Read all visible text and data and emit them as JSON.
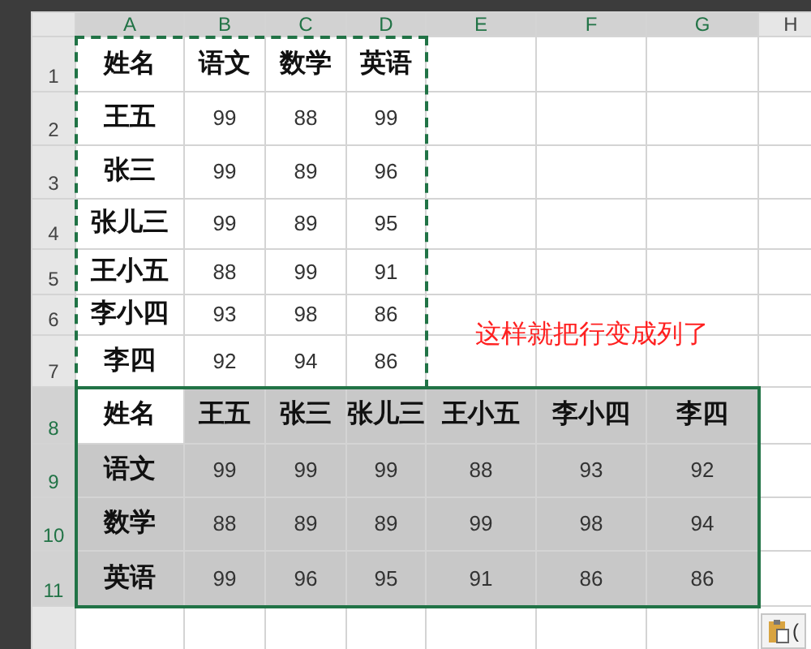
{
  "column_headers": [
    {
      "label": "A",
      "selected": true
    },
    {
      "label": "B",
      "selected": true
    },
    {
      "label": "C",
      "selected": true
    },
    {
      "label": "D",
      "selected": true
    },
    {
      "label": "E",
      "selected": true
    },
    {
      "label": "F",
      "selected": true
    },
    {
      "label": "G",
      "selected": true
    },
    {
      "label": "H",
      "selected": false
    }
  ],
  "row_headers": [
    {
      "label": "1",
      "selected": false
    },
    {
      "label": "2",
      "selected": false
    },
    {
      "label": "3",
      "selected": false
    },
    {
      "label": "4",
      "selected": false
    },
    {
      "label": "5",
      "selected": false
    },
    {
      "label": "6",
      "selected": false
    },
    {
      "label": "7",
      "selected": false
    },
    {
      "label": "8",
      "selected": true
    },
    {
      "label": "9",
      "selected": true
    },
    {
      "label": "10",
      "selected": true
    },
    {
      "label": "11",
      "selected": true
    }
  ],
  "original_table": {
    "header": [
      "姓名",
      "语文",
      "数学",
      "英语"
    ],
    "rows": [
      {
        "name": "王五",
        "scores": [
          "99",
          "88",
          "99"
        ]
      },
      {
        "name": "张三",
        "scores": [
          "99",
          "89",
          "96"
        ]
      },
      {
        "name": "张儿三",
        "scores": [
          "99",
          "89",
          "95"
        ]
      },
      {
        "name": "王小五",
        "scores": [
          "88",
          "99",
          "91"
        ]
      },
      {
        "name": "李小四",
        "scores": [
          "93",
          "98",
          "86"
        ]
      },
      {
        "name": "李四",
        "scores": [
          "92",
          "94",
          "86"
        ]
      }
    ]
  },
  "transposed_table": {
    "corner": {
      "text": "姓名",
      "active": true
    },
    "header": [
      "王五",
      "张三",
      "张儿三",
      "王小五",
      "李小四",
      "李四"
    ],
    "rows": [
      {
        "subject": "语文",
        "scores": [
          "99",
          "99",
          "99",
          "88",
          "93",
          "92"
        ]
      },
      {
        "subject": "数学",
        "scores": [
          "88",
          "89",
          "89",
          "99",
          "98",
          "94"
        ]
      },
      {
        "subject": "英语",
        "scores": [
          "99",
          "96",
          "95",
          "91",
          "86",
          "86"
        ]
      }
    ]
  },
  "annotation": "这样就把行变成列了",
  "paste_options_button": {
    "label": "("
  }
}
